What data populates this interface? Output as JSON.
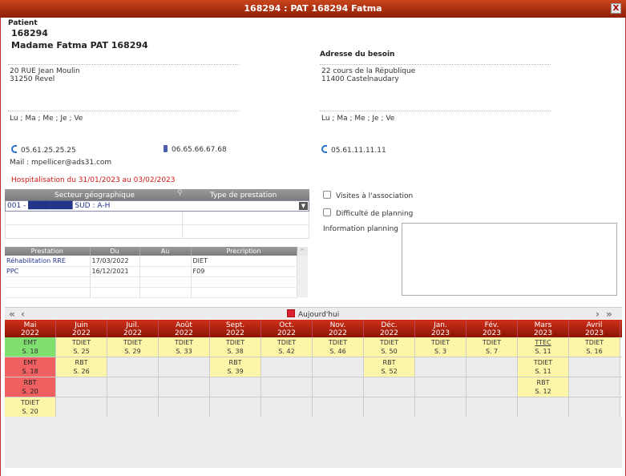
{
  "window": {
    "title": "168294 : PAT 168294 Fatma",
    "close_label": "X"
  },
  "patient": {
    "section_label": "Patient",
    "id": "168294",
    "name": "Madame Fatma PAT 168294",
    "address_line1": "20 RUE Jean Moulin",
    "address_line2": "31250 Revel",
    "days": "Lu ; Ma ; Me ; Je ; Ve",
    "phone": "05.61.25.25.25",
    "mobile": "06.65.66.67.68",
    "mail": "Mail : mpellicer@ads31.com",
    "hospitalisation": "Hospitalisation du 31/01/2023 au 03/02/2023"
  },
  "besoin": {
    "heading": "Adresse du besoin",
    "address_line1": "22 cours de la République",
    "address_line2": "11400 Castelnaudary",
    "days": "Lu ; Ma ; Me ; Je ; Ve",
    "phone": "05.61.11.11.11"
  },
  "secteur_grid": {
    "col1": "Secteur géographique",
    "col2": "Type de prestation",
    "selected_value": "001 - ████████ SUD : A-H"
  },
  "presc_table": {
    "headers": [
      "Prestation",
      "Du",
      "Au",
      "Precription"
    ],
    "rows": [
      [
        "Réhabilitation RRE",
        "17/03/2022",
        "",
        "DIET"
      ],
      [
        "PPC",
        "16/12/2021",
        "",
        "F09"
      ]
    ]
  },
  "options": {
    "visites_label": "Visites à l'association",
    "difficulte_label": "Difficulté de planning",
    "info_label": "Information planning"
  },
  "calendar": {
    "today_label": "Aujourd'hui",
    "months": [
      {
        "m": "Mai",
        "y": "2022"
      },
      {
        "m": "Juin",
        "y": "2022"
      },
      {
        "m": "Juil.",
        "y": "2022"
      },
      {
        "m": "Août",
        "y": "2022"
      },
      {
        "m": "Sept.",
        "y": "2022"
      },
      {
        "m": "Oct.",
        "y": "2022"
      },
      {
        "m": "Nov.",
        "y": "2022"
      },
      {
        "m": "Déc.",
        "y": "2022"
      },
      {
        "m": "Jan.",
        "y": "2023"
      },
      {
        "m": "Fév.",
        "y": "2023"
      },
      {
        "m": "Mars",
        "y": "2023"
      },
      {
        "m": "Avril",
        "y": "2023"
      }
    ],
    "rows": [
      [
        {
          "c": "EMT",
          "s": "S. 18",
          "color": "green"
        },
        {
          "c": "TDIET",
          "s": "S. 25",
          "color": "yellow"
        },
        {
          "c": "TDIET",
          "s": "S. 29",
          "color": "yellow"
        },
        {
          "c": "TDIET",
          "s": "S. 33",
          "color": "yellow"
        },
        {
          "c": "TDIET",
          "s": "S. 38",
          "color": "yellow"
        },
        {
          "c": "TDIET",
          "s": "S. 42",
          "color": "yellow"
        },
        {
          "c": "TDIET",
          "s": "S. 46",
          "color": "yellow"
        },
        {
          "c": "TDIET",
          "s": "S. 50",
          "color": "yellow"
        },
        {
          "c": "TDIET",
          "s": "S. 3",
          "color": "yellow"
        },
        {
          "c": "TDIET",
          "s": "S. 7",
          "color": "yellow"
        },
        {
          "c": "TTEC",
          "s": "S. 11",
          "color": "yellow",
          "underline": true
        },
        {
          "c": "TDIET",
          "s": "S. 16",
          "color": "yellow"
        }
      ],
      [
        {
          "c": "EMT",
          "s": "S. 18",
          "color": "red"
        },
        {
          "c": "RBT",
          "s": "S. 26",
          "color": "yellow"
        },
        null,
        null,
        {
          "c": "RBT",
          "s": "S. 39",
          "color": "yellow"
        },
        null,
        null,
        {
          "c": "RBT",
          "s": "S. 52",
          "color": "yellow"
        },
        null,
        null,
        {
          "c": "TDIET",
          "s": "S. 11",
          "color": "yellow"
        },
        null
      ],
      [
        {
          "c": "RBT",
          "s": "S. 20",
          "color": "red"
        },
        null,
        null,
        null,
        null,
        null,
        null,
        null,
        null,
        null,
        {
          "c": "RBT",
          "s": "S. 12",
          "color": "yellow"
        },
        null
      ],
      [
        {
          "c": "TDIET",
          "s": "S. 20",
          "color": "yellow"
        },
        null,
        null,
        null,
        null,
        null,
        null,
        null,
        null,
        null,
        null,
        null
      ]
    ]
  }
}
